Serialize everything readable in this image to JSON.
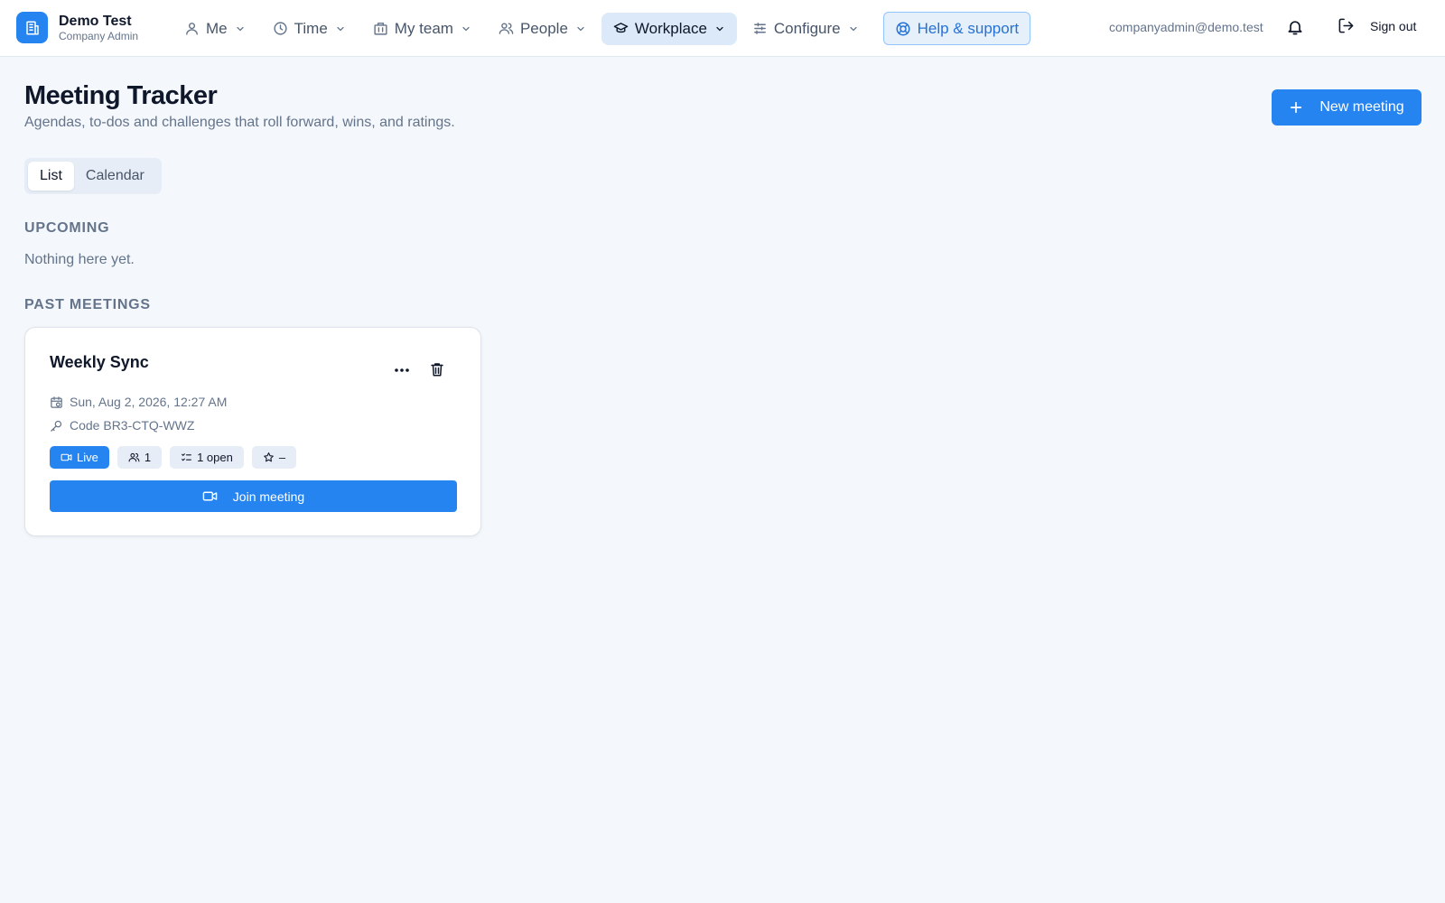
{
  "brand": {
    "name": "Demo Test",
    "role": "Company Admin",
    "accent": "#2584f0"
  },
  "nav": {
    "items": [
      {
        "label": "Me",
        "icon": "user-icon"
      },
      {
        "label": "Time",
        "icon": "clock-icon"
      },
      {
        "label": "My team",
        "icon": "building-icon"
      },
      {
        "label": "People",
        "icon": "users-icon"
      },
      {
        "label": "Workplace",
        "icon": "graduation-cap-icon",
        "active": true
      },
      {
        "label": "Configure",
        "icon": "sliders-icon"
      }
    ],
    "help_label": "Help & support"
  },
  "user": {
    "email": "companyadmin@demo.test",
    "signout_label": "Sign out"
  },
  "page": {
    "title": "Meeting Tracker",
    "subtitle": "Agendas, to-dos and challenges that roll forward, wins, and ratings.",
    "new_meeting_label": "New meeting"
  },
  "view_toggle": {
    "list_label": "List",
    "calendar_label": "Calendar",
    "selected": "List"
  },
  "upcoming": {
    "heading": "UPCOMING",
    "empty_text": "Nothing here yet."
  },
  "past": {
    "heading": "PAST MEETINGS",
    "meetings": [
      {
        "title": "Weekly Sync",
        "datetime": "Sun, Aug 2, 2026, 12:27 AM",
        "code": "Code BR3-CTQ-WWZ",
        "status": "Live",
        "participants": "1",
        "open_todos": "1 open",
        "rating": "–",
        "join_label": "Join meeting"
      }
    ]
  }
}
